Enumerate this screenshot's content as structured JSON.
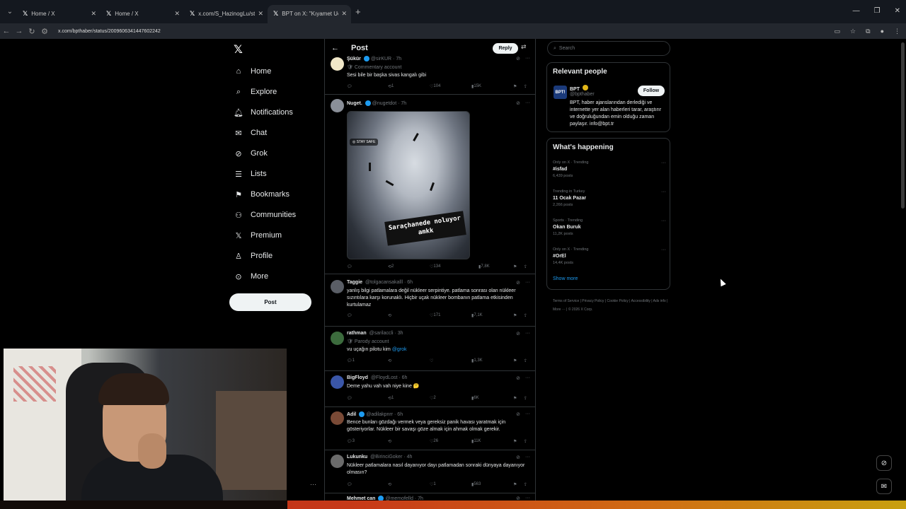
{
  "browser": {
    "tabs": [
      {
        "title": "Home / X"
      },
      {
        "title": "Home / X"
      },
      {
        "title": "x.com/S_HazinogLu/status/200"
      },
      {
        "title": "BPT on X: \"Kıyamet Uçağı olara"
      }
    ],
    "url": "x.com/bpthaber/status/2009606341447602242"
  },
  "nav": {
    "items": [
      "Home",
      "Explore",
      "Notifications",
      "Chat",
      "Grok",
      "Lists",
      "Bookmarks",
      "Communities",
      "Premium",
      "Profile",
      "More"
    ],
    "post_label": "Post"
  },
  "header": {
    "title": "Post",
    "reply_label": "Reply"
  },
  "tweets": [
    {
      "name": "Şükür",
      "handle": "@sirKUR · 7h",
      "label": "Commentary account",
      "text": "Sesi bile bir başka sivas kangalı gibi",
      "stats": {
        "reply": "",
        "retweet": "1",
        "like": "104",
        "views": "15K"
      }
    },
    {
      "name": "Nuget.",
      "handle": "@nugetdot · 7h",
      "media_badge": "STAY SAFE",
      "media_caption": "Saraçhanede noluyor amkk",
      "stats": {
        "reply": "",
        "retweet": "2",
        "like": "134",
        "views": "7,8K"
      }
    },
    {
      "name": "Taggie",
      "handle": "@tolgacansakalll · 6h",
      "text": "yanlış bilgi patlamalara değil nükleer serpintiye. patlama sonrası olan nükleer sızıntılara karşı korunaklı. Hiçbir uçak nükleer bombanın patlama etkisinden kurtulamaz",
      "stats": {
        "reply": "",
        "retweet": "",
        "like": "171",
        "views": "7,1K"
      }
    },
    {
      "name": "rathman",
      "handle": "@sarilaccli · 3h",
      "label": "Parody account",
      "text": "vu uçağın pilotu kim",
      "mention": "@grok",
      "stats": {
        "reply": "1",
        "retweet": "",
        "like": "",
        "views": "1,3K"
      }
    },
    {
      "name": "BigFloyd",
      "handle": "@FloydLost · 6h",
      "text": "Deme yahu vah vah niye kine 🤔",
      "stats": {
        "reply": "",
        "retweet": "1",
        "like": "2",
        "views": "6K"
      }
    },
    {
      "name": "Adil",
      "handle": "@adilakpnrr · 6h",
      "text": "Bence bunları gözdağı vermek veya gereksiz panik havası yaratmak için gösteriyorlar. Nükleer bir savaşı göze almak için ahmak olmak gerekir.",
      "stats": {
        "reply": "3",
        "retweet": "",
        "like": "26",
        "views": "11K"
      }
    },
    {
      "name": "Lukunku",
      "handle": "@BirinciGoker · 4h",
      "text": "Nükleer patlamalara nasıl dayanıyor dayı patlamadan sonraki dünyaya dayanıyor olmasın?",
      "stats": {
        "reply": "",
        "retweet": "",
        "like": "1",
        "views": "563"
      }
    },
    {
      "name": "Mehmet can",
      "handle": "@memofelld · 7h"
    }
  ],
  "right": {
    "search_placeholder": "Search",
    "relevant_title": "Relevant people",
    "person": {
      "avatar_text": "BPT!",
      "name": "BPT",
      "handle": "@bpthaber",
      "follow_label": "Follow",
      "bio": "BPT, haber ajanslarından derlediği ve internette yer alan haberleri tarar, araştırır ve doğruluğundan emin olduğu zaman paylaşır. info@bpt.tr"
    },
    "happening_title": "What's happening",
    "trends": [
      {
        "meta": "Only on X · Trending",
        "name": "#isfad",
        "count": "6,439 posts"
      },
      {
        "meta": "Trending in Turkey",
        "name": "11 Ocak Pazar",
        "count": "2,266 posts"
      },
      {
        "meta": "Sports · Trending",
        "name": "Okan Buruk",
        "count": "11,2K posts"
      },
      {
        "meta": "Only on X · Trending",
        "name": "#OrEl",
        "count": "14,4K posts"
      }
    ],
    "show_more": "Show more",
    "footer": "Terms of Service  |  Privacy Policy  |  Cookie Policy  |  Accessibility  |  Ads info  |  More ···  |  © 2026 X Corp."
  },
  "colors": {
    "accent": "#1d9bf0",
    "bg": "#000000",
    "border": "#2f3336",
    "muted": "#71767b"
  }
}
